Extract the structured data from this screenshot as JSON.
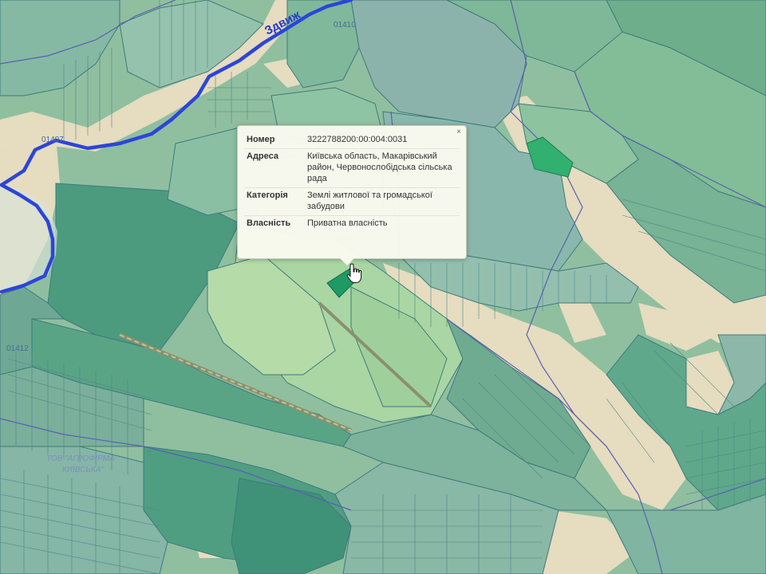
{
  "map": {
    "river_label": "Здвиж",
    "parcel_labels": [
      "01410",
      "01407",
      "01412"
    ],
    "farm_label_line1": "ТОВ \"АГРОФІРМА",
    "farm_label_line2": "КИЇВСЬКА\"",
    "colors": {
      "river": "#2c45d8",
      "parcel_dark": "#4c9b7f",
      "parcel_mid": "#7ab896",
      "parcel_light": "#a9d6a3",
      "parcel_grey": "#8cb3ab",
      "road_beige": "#e8dcc0",
      "selected_parcel": "#1f9a64",
      "boundary": "#5b5fb0"
    }
  },
  "popup": {
    "close_symbol": "×",
    "rows": [
      {
        "key": "Номер",
        "value": "3222788200:00:004:0031"
      },
      {
        "key": "Адреса",
        "value": "Київська область, Макарівський район, Червонослобідська сільська рада"
      },
      {
        "key": "Категорія",
        "value": "Землі житлової та громадської забудови"
      },
      {
        "key": "Власність",
        "value": "Приватна власність"
      }
    ]
  }
}
